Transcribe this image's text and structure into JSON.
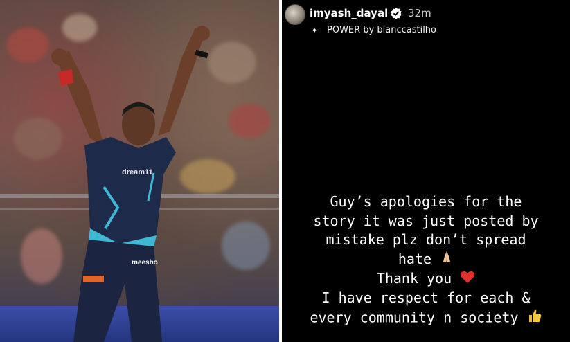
{
  "story": {
    "username": "imyash_dayal",
    "time": "32m",
    "music": "POWER by bianccastilho",
    "lines": [
      "Guy’s apologies for the",
      "story it was just posted by",
      "mistake plz don’t spread",
      "hate",
      "Thank you",
      "I have respect for each &",
      "every community n society"
    ],
    "icons": {
      "verified": "verified-badge-icon",
      "music": "sparkle-music-icon",
      "pray": "folded-hands-emoji",
      "heart": "red-heart-emoji",
      "thumbs": "thumbs-up-emoji"
    }
  },
  "photo": {
    "jersey_text": "dream11",
    "shorts_text": "meesho",
    "colors": {
      "jersey": "#1e2a4a",
      "accent": "#3fb8d6"
    }
  }
}
